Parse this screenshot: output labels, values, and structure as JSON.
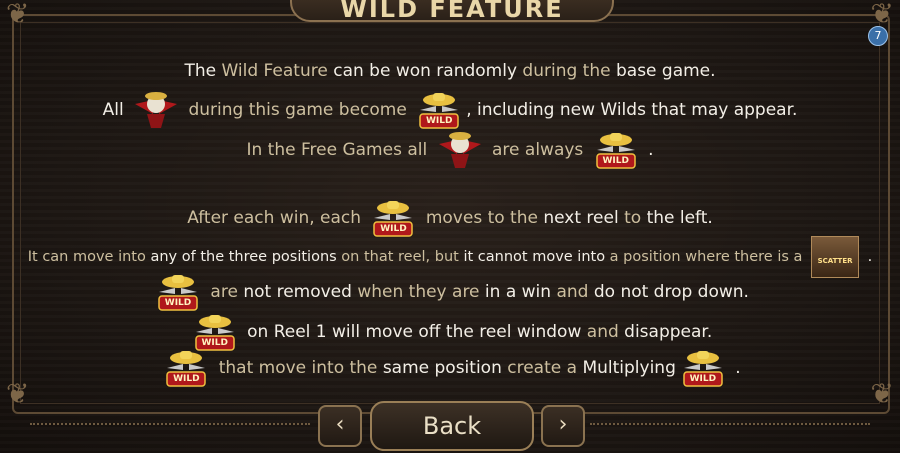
{
  "title": "WILD FEATURE",
  "info_icon": "7",
  "lines": [
    [
      {
        "t": "The ",
        "c": "w"
      },
      {
        "t": "Wild Feature",
        "c": "g"
      },
      {
        "t": " can be ",
        "c": "w"
      },
      {
        "t": "won randomly",
        "c": "w"
      },
      {
        "t": " during the ",
        "c": "g"
      },
      {
        "t": "base game.",
        "c": "w"
      }
    ],
    [
      {
        "t": "All ",
        "c": "w"
      },
      {
        "sym": "eagle"
      },
      {
        "t": " during this game become ",
        "c": "g"
      },
      {
        "sym": "wild"
      },
      {
        "t": ", including new Wilds that may appear.",
        "c": "w"
      }
    ],
    [
      {
        "t": "In the Free Games all ",
        "c": "g"
      },
      {
        "sym": "eagle"
      },
      {
        "t": " are always ",
        "c": "g"
      },
      {
        "sym": "wild"
      },
      {
        "t": " .",
        "c": "w"
      }
    ],
    [
      {
        "t": "After each win, each ",
        "c": "g"
      },
      {
        "sym": "wild"
      },
      {
        "t": " moves to the ",
        "c": "g"
      },
      {
        "t": "next reel",
        "c": "w"
      },
      {
        "t": " to ",
        "c": "g"
      },
      {
        "t": "the left.",
        "c": "w"
      }
    ],
    [
      {
        "t": "It can move into ",
        "c": "g"
      },
      {
        "t": "any of the three positions",
        "c": "w"
      },
      {
        "t": " on that reel, but ",
        "c": "g"
      },
      {
        "t": "it cannot move into",
        "c": "w"
      },
      {
        "t": " a position where there is a ",
        "c": "g"
      },
      {
        "sym": "scatter"
      },
      {
        "t": " .",
        "c": "w"
      }
    ],
    [
      {
        "sym": "wild"
      },
      {
        "t": " are ",
        "c": "g"
      },
      {
        "t": "not removed",
        "c": "w"
      },
      {
        "t": " when they are ",
        "c": "g"
      },
      {
        "t": "in a win",
        "c": "w"
      },
      {
        "t": " and ",
        "c": "g"
      },
      {
        "t": "do not drop down.",
        "c": "w"
      }
    ],
    [
      {
        "sym": "wild"
      },
      {
        "t": " on Reel 1 will ",
        "c": "w"
      },
      {
        "t": "move off the reel window",
        "c": "w"
      },
      {
        "t": " and ",
        "c": "g"
      },
      {
        "t": "disappear.",
        "c": "w"
      }
    ],
    [
      {
        "sym": "wild"
      },
      {
        "t": " that move into the ",
        "c": "g"
      },
      {
        "t": "same position",
        "c": "w"
      },
      {
        "t": " create a ",
        "c": "g"
      },
      {
        "t": "Multiplying",
        "c": "w"
      },
      {
        "sym": "wild"
      },
      {
        "t": " .",
        "c": "w"
      }
    ]
  ],
  "symbols": {
    "wild_label": "WILD",
    "scatter_label": "SCATTER"
  },
  "nav": {
    "prev": "‹",
    "back": "Back",
    "next": "›"
  }
}
